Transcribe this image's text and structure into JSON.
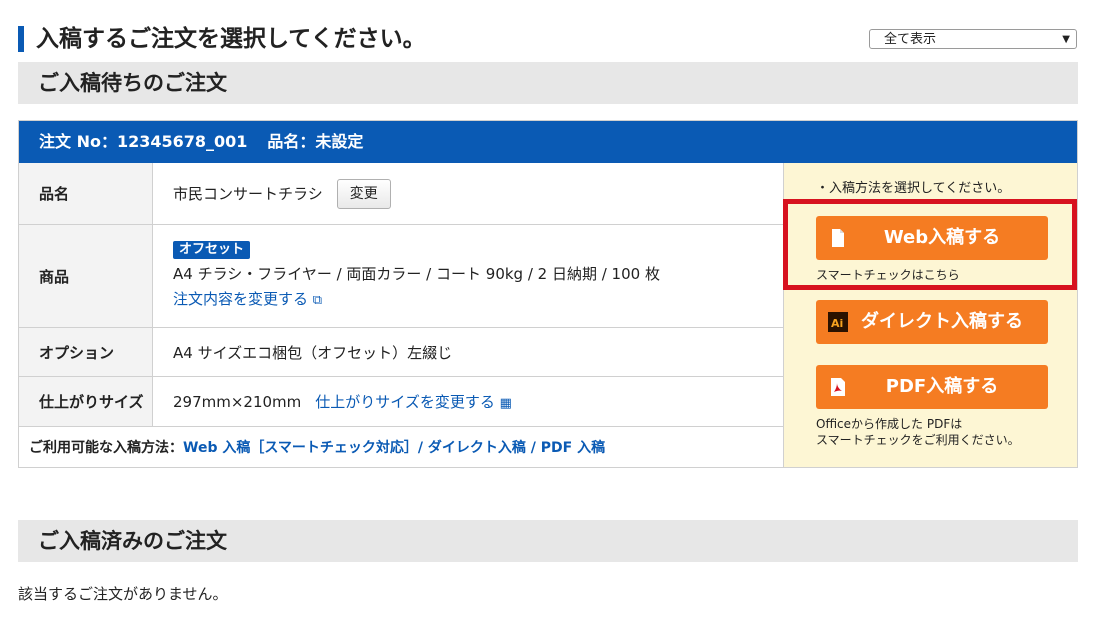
{
  "page": {
    "title": "入稿するご注文を選択してください。",
    "filter": {
      "value": "全て表示"
    }
  },
  "pending_section": {
    "title": "ご入稿待ちのご注文"
  },
  "order": {
    "number_label": "注文 No：12345678_001",
    "name_label": "品名：未設定",
    "rows": {
      "name": {
        "label": "品名",
        "value": "市民コンサートチラシ",
        "change_button": "変更"
      },
      "product": {
        "label": "商品",
        "badge": "オフセット",
        "spec": "A4 チラシ・フライヤー / 両面カラー / コート 90kg / 2 日納期 / 100 枚",
        "change_link": "注文内容を変更する"
      },
      "option": {
        "label": "オプション",
        "value": "A4 サイズエコ梱包（オフセット）左綴じ"
      },
      "size": {
        "label": "仕上がりサイズ",
        "value": "297mm×210mm",
        "change_link": "仕上がりサイズを変更する"
      }
    },
    "methods": {
      "label": "ご利用可能な入稿方法：",
      "value": "Web 入稿［スマートチェック対応］/ ダイレクト入稿 / PDF 入稿"
    }
  },
  "side_panel": {
    "note": "・入稿方法を選択してください。",
    "web_button": "Web入稿する",
    "web_note": "スマートチェックはこちら",
    "direct_button": "ダイレクト入稿する",
    "pdf_button": "PDF入稿する",
    "pdf_note_line1": "Officeから作成した PDFは",
    "pdf_note_line2": "スマートチェックをご利用ください。",
    "colors": {
      "button": "#f57c22",
      "highlight": "#d7121f",
      "panel_bg": "#fdf6d4"
    }
  },
  "completed_section": {
    "title": "ご入稿済みのご注文",
    "empty_message": "該当するご注文がありません。"
  },
  "colors": {
    "brand_blue": "#0a5ab4",
    "section_gray": "#e7e7e7"
  }
}
